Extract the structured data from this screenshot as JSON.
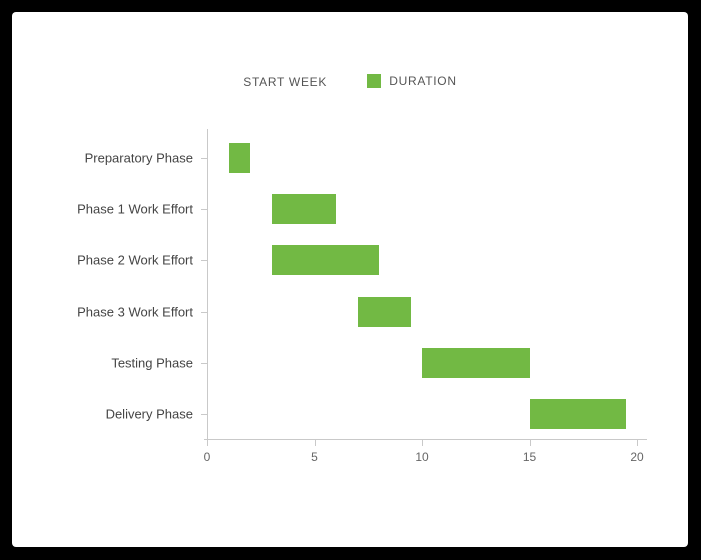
{
  "legend": {
    "start_week": "START WEEK",
    "duration": "DURATION"
  },
  "chart_data": {
    "type": "bar",
    "orientation": "horizontal",
    "stacked_gantt": true,
    "categories": [
      "Preparatory Phase",
      "Phase 1 Work Effort",
      "Phase 2 Work Effort",
      "Phase 3 Work Effort",
      "Testing Phase",
      "Delivery Phase"
    ],
    "series": [
      {
        "name": "START WEEK",
        "values": [
          1,
          3,
          3,
          7,
          10,
          15
        ]
      },
      {
        "name": "DURATION",
        "values": [
          1,
          3,
          5,
          2.5,
          5,
          4.5
        ]
      }
    ],
    "xlabel": "",
    "ylabel": "",
    "xlim": [
      0,
      20
    ],
    "x_ticks": [
      0,
      5,
      10,
      15,
      20
    ],
    "series_colors": {
      "START WEEK": "transparent",
      "DURATION": "#72b944"
    }
  }
}
